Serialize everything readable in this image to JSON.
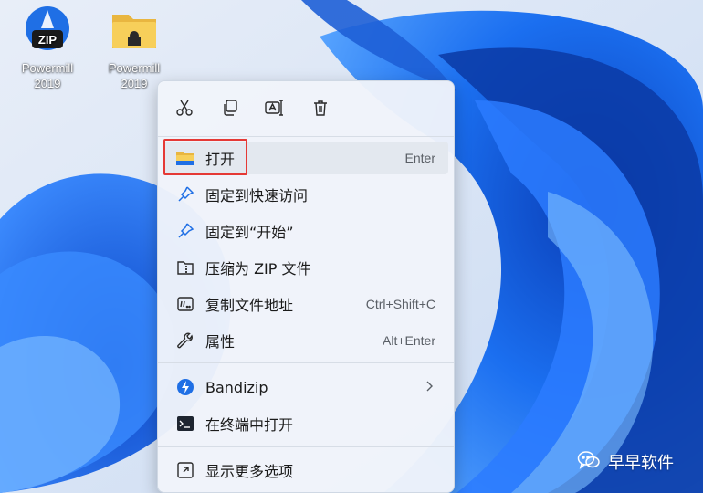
{
  "desktop": {
    "icons": [
      {
        "name_line1": "Powermill",
        "name_line2": "2019",
        "type": "zip-archive-icon",
        "badge": "ZIP"
      },
      {
        "name_line1": "Powermill",
        "name_line2": "2019",
        "type": "folder-icon"
      }
    ]
  },
  "context_menu": {
    "toolbar": [
      {
        "name": "cut",
        "icon": "scissors-icon"
      },
      {
        "name": "copy",
        "icon": "copy-icon"
      },
      {
        "name": "rename",
        "icon": "rename-icon"
      },
      {
        "name": "delete",
        "icon": "trash-icon"
      }
    ],
    "items": [
      {
        "label": "打开",
        "shortcut": "Enter",
        "icon": "folder-icon",
        "highlighted": true
      },
      {
        "label": "固定到快速访问",
        "shortcut": "",
        "icon": "pin-icon"
      },
      {
        "label": "固定到“开始”",
        "shortcut": "",
        "icon": "pin-icon"
      },
      {
        "label": "压缩为 ZIP 文件",
        "shortcut": "",
        "icon": "zip-folder-icon"
      },
      {
        "label": "复制文件地址",
        "shortcut": "Ctrl+Shift+C",
        "icon": "copy-path-icon"
      },
      {
        "label": "属性",
        "shortcut": "Alt+Enter",
        "icon": "wrench-icon"
      },
      {
        "label": "Bandizip",
        "shortcut": "",
        "icon": "bandizip-icon",
        "submenu": true
      },
      {
        "label": "在终端中打开",
        "shortcut": "",
        "icon": "terminal-icon"
      },
      {
        "label": "显示更多选项",
        "shortcut": "",
        "icon": "more-options-icon"
      }
    ]
  },
  "watermark": {
    "text": "早早软件"
  },
  "colors": {
    "accent": "#1f6fe5",
    "highlight_box": "#e53935",
    "menu_bg": "#f0f4fa"
  }
}
